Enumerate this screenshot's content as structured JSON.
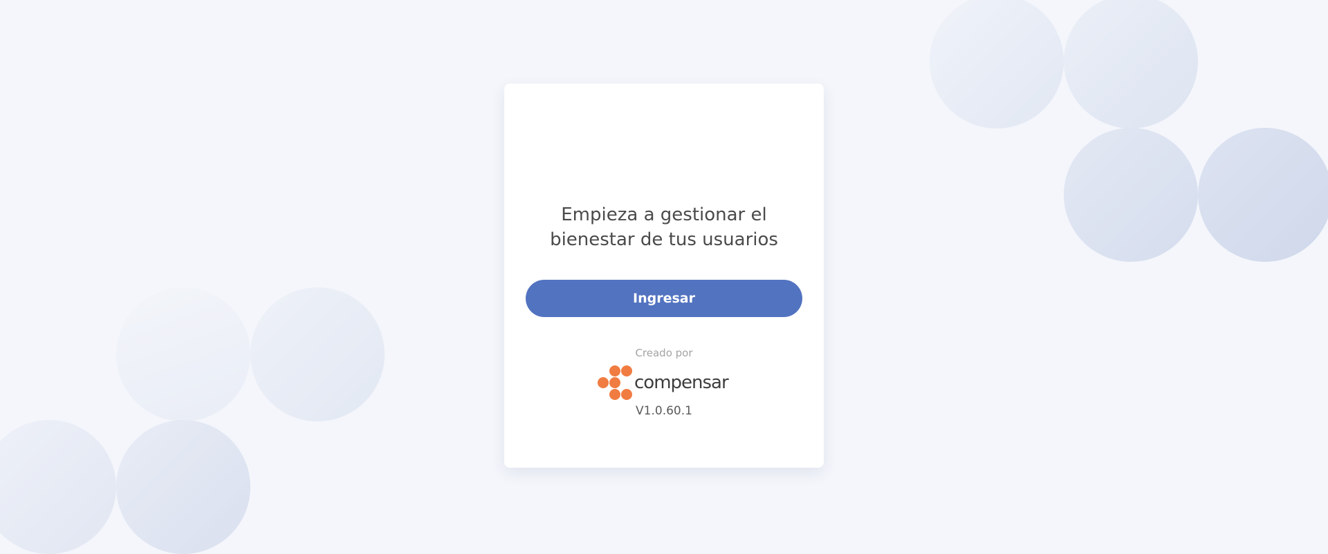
{
  "card": {
    "headline_line1": "Empieza a gestionar el",
    "headline_line2": "bienestar de tus usuarios",
    "login_button": "Ingresar",
    "created_by": "Creado por",
    "brand_name": "compensar",
    "version": "V1.0.60.1"
  },
  "colors": {
    "background": "#f4f6fb",
    "primary_button": "#5273c0",
    "brand_orange": "#f07c42"
  },
  "icons": {
    "brand_logo": "compensar-logo-icon"
  }
}
